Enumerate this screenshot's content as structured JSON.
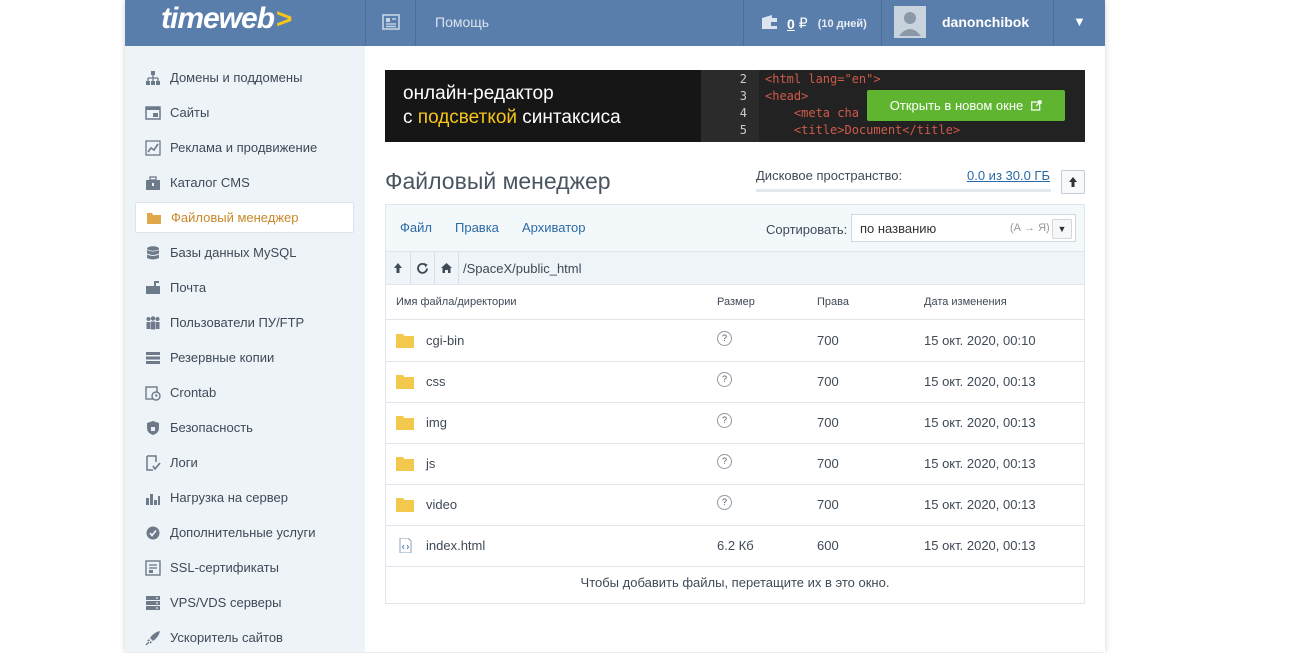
{
  "header": {
    "logo": "timeweb",
    "help_label": "Помощь",
    "balance_value": "0",
    "balance_currency": "₽",
    "balance_days": "(10 дней)",
    "username": "danonchibok"
  },
  "sidebar": {
    "items": [
      {
        "label": "Домены и поддомены",
        "icon": "sitemap-icon"
      },
      {
        "label": "Сайты",
        "icon": "browser-window-icon"
      },
      {
        "label": "Реклама и продвижение",
        "icon": "line-chart-icon"
      },
      {
        "label": "Каталог CMS",
        "icon": "briefcase-icon"
      },
      {
        "label": "Файловый менеджер",
        "icon": "folder-icon",
        "active": true
      },
      {
        "label": "Базы данных MySQL",
        "icon": "database-icon"
      },
      {
        "label": "Почта",
        "icon": "mailbox-icon"
      },
      {
        "label": "Пользователи ПУ/FTP",
        "icon": "users-icon"
      },
      {
        "label": "Резервные копии",
        "icon": "server-stack-icon"
      },
      {
        "label": "Crontab",
        "icon": "calendar-clock-icon"
      },
      {
        "label": "Безопасность",
        "icon": "shield-icon"
      },
      {
        "label": "Логи",
        "icon": "log-check-icon"
      },
      {
        "label": "Нагрузка на сервер",
        "icon": "bar-chart-icon"
      },
      {
        "label": "Дополнительные услуги",
        "icon": "gear-check-icon"
      },
      {
        "label": "SSL-сертификаты",
        "icon": "certificate-icon"
      },
      {
        "label": "VPS/VDS серверы",
        "icon": "servers-icon"
      },
      {
        "label": "Ускоритель сайтов",
        "icon": "rocket-icon"
      }
    ]
  },
  "banner": {
    "line1": "онлайн-редактор",
    "line2_prefix": "с ",
    "line2_highlight": "подсветкой",
    "line2_suffix": " синтаксиса",
    "button_label": "Открыть в новом окне",
    "code_lines": [
      {
        "num": "2",
        "text": "<html lang=\"en\">"
      },
      {
        "num": "3",
        "text": "<head>"
      },
      {
        "num": "4",
        "text": "    <meta cha"
      },
      {
        "num": "5",
        "text": "    <title>Document</title>"
      }
    ]
  },
  "page": {
    "title": "Файловый менеджер",
    "disk_label": "Дисковое пространство:",
    "disk_value": "0.0 из 30.0 ГБ",
    "disk_used_fraction": 0.0
  },
  "file_manager": {
    "menu": [
      "Файл",
      "Правка",
      "Архиватор"
    ],
    "sort_label": "Сортировать:",
    "sort_value": "по названию",
    "sort_order": "(А → Я)",
    "path": "/SpaceX/public_html",
    "columns": [
      "Имя файла/директории",
      "Размер",
      "Права",
      "Дата изменения"
    ],
    "rows": [
      {
        "name": "cgi-bin",
        "type": "folder",
        "size": "?",
        "perms": "700",
        "date": "15 окт. 2020, 00:10"
      },
      {
        "name": "css",
        "type": "folder",
        "size": "?",
        "perms": "700",
        "date": "15 окт. 2020, 00:13"
      },
      {
        "name": "img",
        "type": "folder",
        "size": "?",
        "perms": "700",
        "date": "15 окт. 2020, 00:13"
      },
      {
        "name": "js",
        "type": "folder",
        "size": "?",
        "perms": "700",
        "date": "15 окт. 2020, 00:13"
      },
      {
        "name": "video",
        "type": "folder",
        "size": "?",
        "perms": "700",
        "date": "15 окт. 2020, 00:13"
      },
      {
        "name": "index.html",
        "type": "file",
        "size": "6.2 Кб",
        "perms": "600",
        "date": "15 окт. 2020, 00:13"
      }
    ],
    "drop_hint": "Чтобы добавить файлы, перетащите их в это окно."
  },
  "colors": {
    "header_bg": "#5a7eab",
    "sidebar_bg": "#eef3f8",
    "active_label": "#c8882a",
    "link": "#2c6aa6",
    "button_green": "#5fb530",
    "folder": "#f2c94c"
  }
}
